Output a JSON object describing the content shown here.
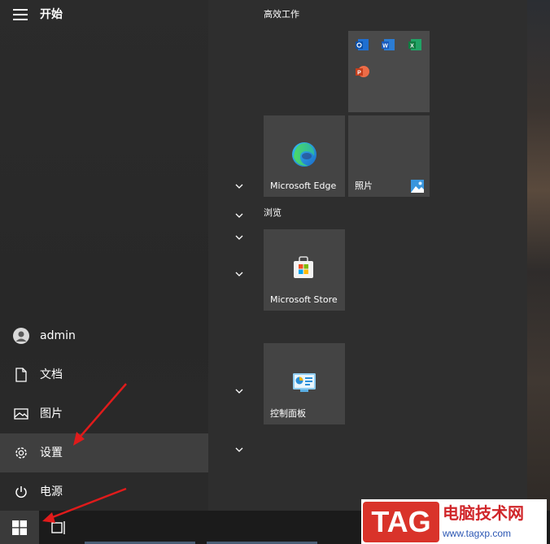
{
  "start": {
    "title": "开始"
  },
  "sidebar": {
    "items": [
      {
        "label": "admin",
        "icon": "user-avatar-icon"
      },
      {
        "label": "文档",
        "icon": "document-icon"
      },
      {
        "label": "图片",
        "icon": "picture-icon"
      },
      {
        "label": "设置",
        "icon": "gear-icon",
        "active": true
      },
      {
        "label": "电源",
        "icon": "power-icon"
      }
    ]
  },
  "groups": [
    {
      "title": "高效工作"
    },
    {
      "title": "浏览"
    }
  ],
  "tiles": {
    "office": {
      "icons": [
        "outlook-icon",
        "word-icon",
        "excel-icon",
        "powerpoint-icon"
      ]
    },
    "edge": {
      "label": "Microsoft Edge"
    },
    "photos": {
      "label": "照片"
    },
    "store": {
      "label": "Microsoft Store"
    },
    "control_panel": {
      "label": "控制面板"
    }
  },
  "watermark": {
    "tag": "TAG",
    "site_name": "电脑技术网",
    "url": "www.tagxp.com"
  },
  "colors": {
    "active_item": "#3f3f3f",
    "tile": "#444444",
    "arrow": "#e01b1b"
  }
}
